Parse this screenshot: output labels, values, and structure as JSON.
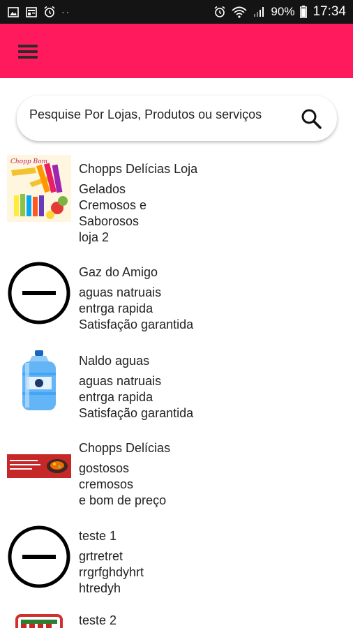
{
  "status_bar": {
    "battery": "90%",
    "time": "17:34",
    "icons": [
      "image-icon",
      "news-icon",
      "alarm-icon",
      "alarm-icon",
      "wifi-icon",
      "signal-icon",
      "battery-icon"
    ]
  },
  "app_bar": {
    "color": "#ff1a5e",
    "menu_icon": "hamburger-menu-icon"
  },
  "search": {
    "placeholder": "Pesquise Por Lojas, Produtos ou serviços",
    "value": "",
    "icon": "search-icon"
  },
  "stores": [
    {
      "name": "Chopps Delícias Loja",
      "desc": [
        "Gelados",
        "Cremosos e",
        "Saborosos",
        "loja 2"
      ],
      "thumb": "chopp-product-photo"
    },
    {
      "name": "Gaz do Amigo",
      "desc": [
        "aguas natruais",
        "entrga rapida",
        "Satisfação garantida"
      ],
      "thumb": "no-image-icon"
    },
    {
      "name": "Naldo aguas",
      "desc": [
        "aguas natruais",
        "entrga rapida",
        "Satisfação garantida"
      ],
      "thumb": "water-gallon-photo"
    },
    {
      "name": "Chopps Delícias",
      "desc": [
        "gostosos",
        "cremosos",
        "e bom de preço"
      ],
      "thumb": "restaurant-banner-photo"
    },
    {
      "name": "teste 1",
      "desc": [
        "grtretret",
        "rrgrfghdyhrt",
        "htredyh"
      ],
      "thumb": "no-image-icon"
    },
    {
      "name": "teste 2",
      "desc": [],
      "thumb": "store-awning-icon"
    }
  ]
}
